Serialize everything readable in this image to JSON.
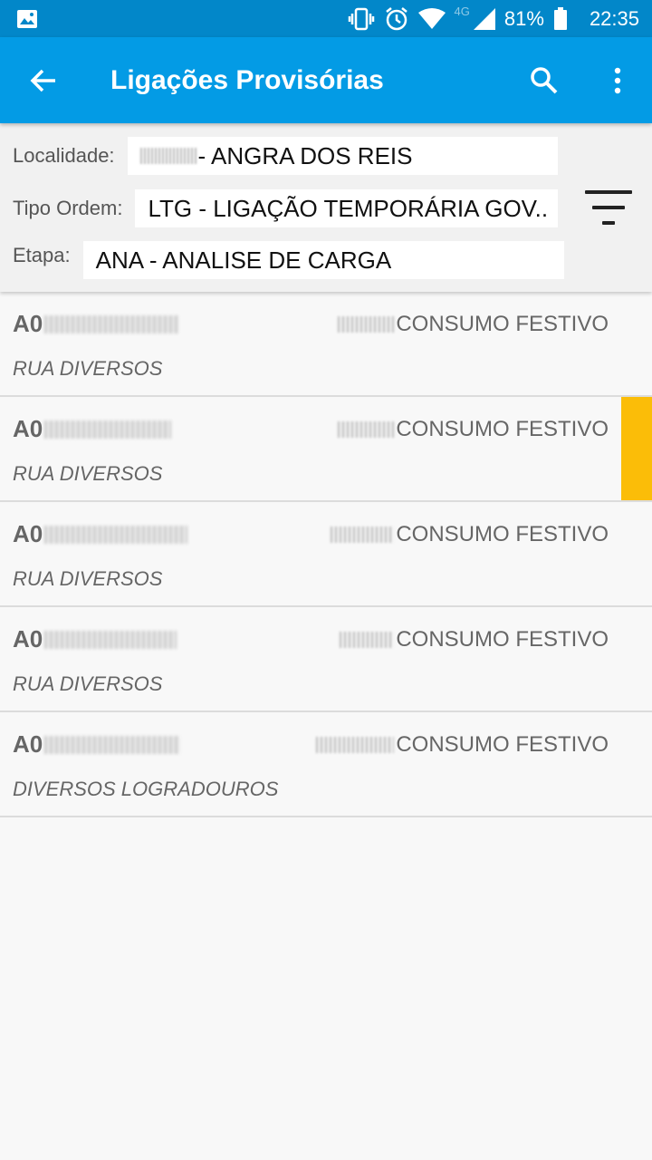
{
  "status_bar": {
    "battery": "81%",
    "time": "22:35",
    "network": "4G"
  },
  "app_bar": {
    "title": "Ligações Provisórias"
  },
  "filters": {
    "localidade_label": "Localidade:",
    "localidade_value": "- ANGRA DOS REIS",
    "tipo_ordem_label": "Tipo Ordem:",
    "tipo_ordem_value": "LTG - LIGAÇÃO TEMPORÁRIA GOV..",
    "etapa_label": "Etapa:",
    "etapa_value": "ANA - ANALISE DE CARGA"
  },
  "rows": [
    {
      "code_prefix": "A0",
      "type": "CONSUMO FESTIVO",
      "address": "RUA DIVERSOS",
      "marker": false
    },
    {
      "code_prefix": "A0",
      "type": "CONSUMO FESTIVO",
      "address": "RUA DIVERSOS",
      "marker": true
    },
    {
      "code_prefix": "A0",
      "type": "CONSUMO FESTIVO",
      "address": "RUA DIVERSOS",
      "marker": false
    },
    {
      "code_prefix": "A0",
      "type": "CONSUMO FESTIVO",
      "address": "RUA DIVERSOS",
      "marker": false
    },
    {
      "code_prefix": "A0",
      "type": "CONSUMO FESTIVO",
      "address": "DIVERSOS LOGRADOUROS",
      "marker": false
    }
  ],
  "colors": {
    "status_bar": "#0287c9",
    "app_bar": "#039be5",
    "marker": "#fbbd08"
  }
}
